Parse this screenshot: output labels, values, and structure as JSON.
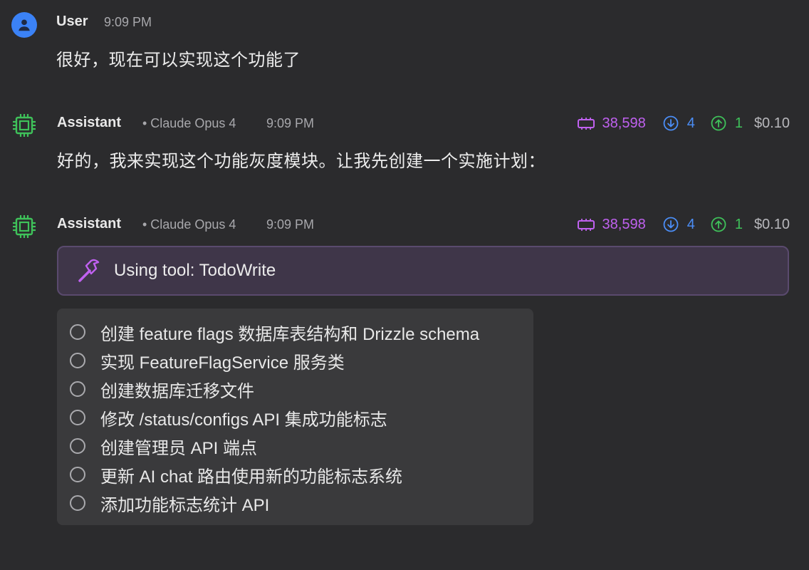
{
  "messages": [
    {
      "role_label": "User",
      "time": "9:09 PM",
      "text": "很好，现在可以实现这个功能了"
    },
    {
      "role_label": "Assistant",
      "model": "• Claude Opus 4",
      "time": "9:09 PM",
      "text": "好的，我来实现这个功能灰度模块。让我先创建一个实施计划：",
      "stats": {
        "tokens": "38,598",
        "input": "4",
        "output": "1",
        "cost": "$0.10"
      }
    },
    {
      "role_label": "Assistant",
      "model": "• Claude Opus 4",
      "time": "9:09 PM",
      "stats": {
        "tokens": "38,598",
        "input": "4",
        "output": "1",
        "cost": "$0.10"
      },
      "tool_label": "Using tool: TodoWrite",
      "todos": [
        "创建 feature flags 数据库表结构和 Drizzle schema",
        "实现 FeatureFlagService 服务类",
        "创建数据库迁移文件",
        "修改 /status/configs API 集成功能标志",
        "创建管理员 API 端点",
        "更新 AI chat 路由使用新的功能标志系统",
        "添加功能标志统计 API"
      ]
    }
  ],
  "colors": {
    "background": "#2b2b2d",
    "user_avatar": "#3b82f6",
    "bot_icon": "#3fc25a",
    "tokens": "#c061f0",
    "input": "#4b8ef7",
    "output": "#3fc25a",
    "tool_bg": "#3f3649"
  },
  "icons": {
    "user_avatar": "user-icon",
    "bot_avatar": "cpu-chip-icon",
    "tokens": "memory-chip-icon",
    "input": "arrow-down-circle-icon",
    "output": "arrow-up-circle-icon",
    "tool": "hammer-icon",
    "todo": "circle-unchecked-icon"
  }
}
